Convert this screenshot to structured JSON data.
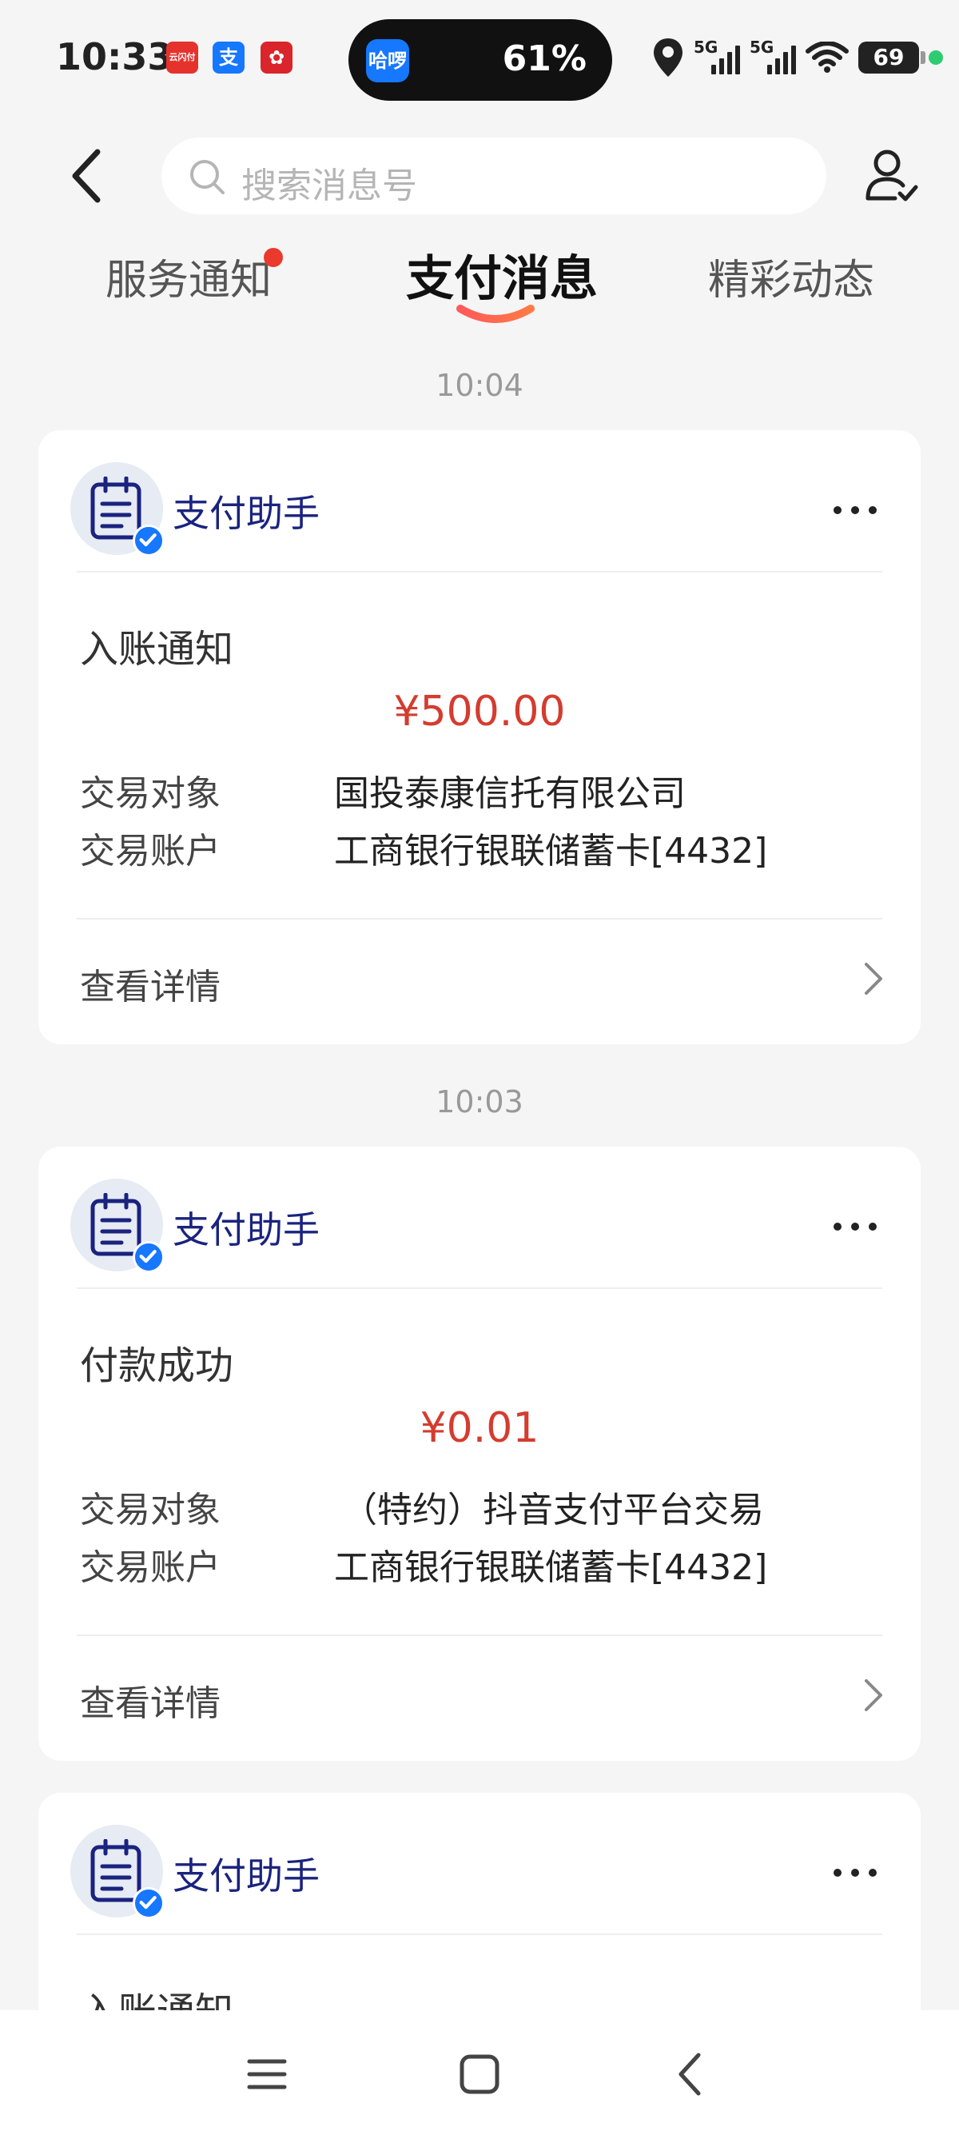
{
  "status_bar": {
    "time": "10:33",
    "app_icons": [
      {
        "name": "yunshanfu-icon",
        "label": "云闪付",
        "color": "#e5322d"
      },
      {
        "name": "alipay-icon",
        "label": "支",
        "color": "#1677ff"
      },
      {
        "name": "huawei-icon",
        "label": "✿",
        "color": "#d9252b"
      }
    ],
    "island_app": "哈啰",
    "island_battery": "61%",
    "signal_1": "5G",
    "signal_2": "5G",
    "battery": "69"
  },
  "header": {
    "search_placeholder": "搜索消息号"
  },
  "tabs": [
    {
      "label": "服务通知",
      "badge": true,
      "active": false
    },
    {
      "label": "支付消息",
      "badge": false,
      "active": true
    },
    {
      "label": "精彩动态",
      "badge": false,
      "active": false
    }
  ],
  "messages": [
    {
      "time": "10:04",
      "sender": "支付助手",
      "title": "入账通知",
      "amount": "¥500.00",
      "rows": [
        {
          "label": "交易对象",
          "value": "国投泰康信托有限公司"
        },
        {
          "label": "交易账户",
          "value": "工商银行银联储蓄卡[4432]"
        }
      ],
      "detail_label": "查看详情"
    },
    {
      "time": "10:03",
      "sender": "支付助手",
      "title": "付款成功",
      "amount": "¥0.01",
      "rows": [
        {
          "label": "交易对象",
          "value": "（特约）抖音支付平台交易"
        },
        {
          "label": "交易账户",
          "value": "工商银行银联储蓄卡[4432]"
        }
      ],
      "detail_label": "查看详情"
    },
    {
      "time": "",
      "sender": "支付助手",
      "title": "入账通知"
    }
  ],
  "colors": {
    "amount": "#d43c2f",
    "sender": "#1a237e",
    "background": "#f5f5f5",
    "badge": "#e93a2d"
  }
}
